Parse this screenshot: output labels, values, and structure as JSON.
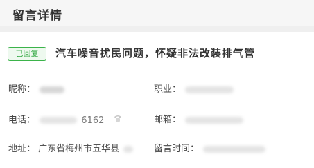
{
  "header": {
    "title": "留言详情"
  },
  "message": {
    "status_badge": "已回复",
    "title": "汽车噪音扰民问题，怀疑非法改装排气管"
  },
  "fields": {
    "nickname_label": "昵称：",
    "occupation_label": "职业：",
    "phone_label": "电话：",
    "phone_value_tail": "6162",
    "email_label": "邮箱：",
    "address_label": "地址：",
    "address_value": "广东省梅州市五华县",
    "time_label": "留言时间："
  },
  "icons": {
    "phone": "phone-icon"
  }
}
